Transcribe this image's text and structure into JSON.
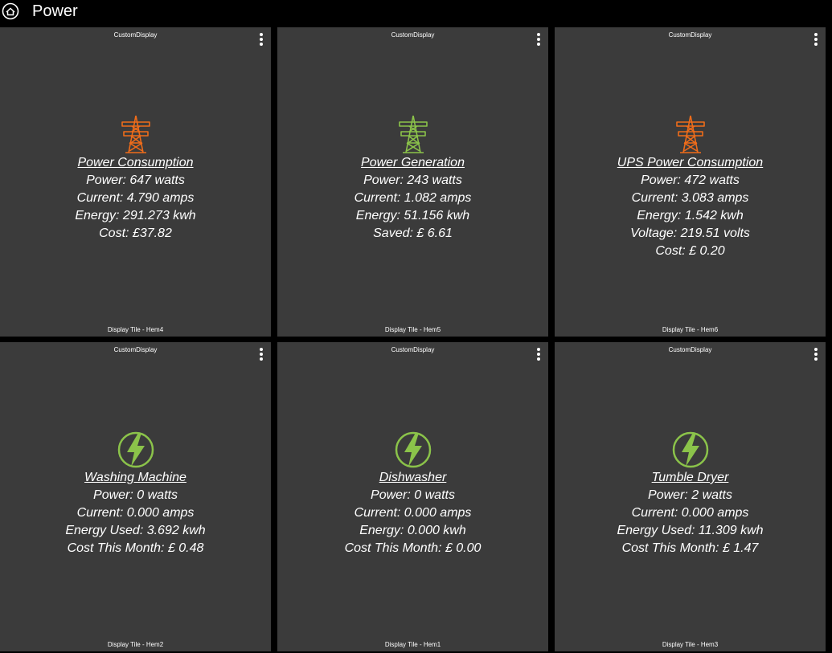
{
  "header": {
    "title": "Power",
    "icon": "home-icon"
  },
  "tiles": [
    {
      "type_label": "CustomDisplay",
      "icon": "pylon-icon",
      "icon_color": "#ef6c1a",
      "heading": "Power Consumption",
      "lines": [
        "Power: 647 watts",
        "Current: 4.790 amps",
        "Energy: 291.273 kwh",
        "Cost: £37.82"
      ],
      "footer": "Display Tile - Hem4"
    },
    {
      "type_label": "CustomDisplay",
      "icon": "pylon-icon",
      "icon_color": "#8bc34a",
      "heading": "Power Generation",
      "lines": [
        "Power: 243 watts",
        "Current: 1.082 amps",
        "Energy: 51.156 kwh",
        "Saved: £ 6.61"
      ],
      "footer": "Display Tile - Hem5"
    },
    {
      "type_label": "CustomDisplay",
      "icon": "pylon-icon",
      "icon_color": "#ef6c1a",
      "heading": "UPS Power Consumption",
      "lines": [
        "Power: 472 watts",
        "Current: 3.083 amps",
        "Energy: 1.542 kwh",
        "Voltage: 219.51 volts",
        "Cost: £ 0.20"
      ],
      "footer": "Display Tile - Hem6"
    },
    {
      "type_label": "CustomDisplay",
      "icon": "lightning-bolt-icon",
      "icon_color": "#8bc34a",
      "heading": "Washing Machine",
      "lines": [
        "Power: 0 watts",
        "Current: 0.000 amps",
        "Energy Used: 3.692 kwh",
        "Cost This Month: £ 0.48"
      ],
      "footer": "Display Tile - Hem2"
    },
    {
      "type_label": "CustomDisplay",
      "icon": "lightning-bolt-icon",
      "icon_color": "#8bc34a",
      "heading": "Dishwasher",
      "lines": [
        "Power: 0 watts",
        "Current: 0.000 amps",
        "Energy: 0.000 kwh",
        "Cost This Month: £ 0.00"
      ],
      "footer": "Display Tile - Hem1"
    },
    {
      "type_label": "CustomDisplay",
      "icon": "lightning-bolt-icon",
      "icon_color": "#8bc34a",
      "heading": "Tumble Dryer",
      "lines": [
        "Power: 2 watts",
        "Current: 0.000 amps",
        "Energy Used: 11.309 kwh",
        "Cost This Month: £ 1.47"
      ],
      "footer": "Display Tile - Hem3"
    }
  ]
}
